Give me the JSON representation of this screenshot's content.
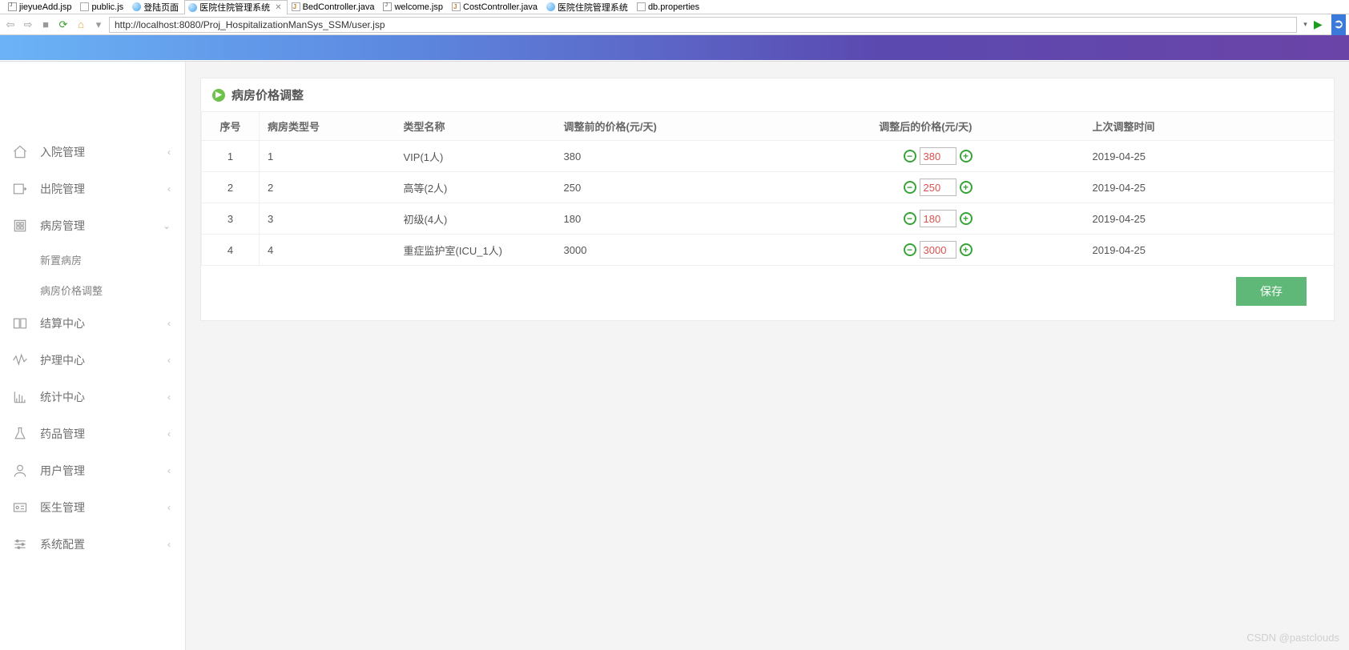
{
  "ide_tabs": [
    {
      "icon": "fi-jsp",
      "label": "jieyueAdd.jsp"
    },
    {
      "icon": "fi-js",
      "label": "public.js"
    },
    {
      "icon": "fi-world",
      "label": "登陆页面"
    },
    {
      "icon": "fi-world",
      "label": "医院住院管理系统",
      "active": true
    },
    {
      "icon": "fi-java",
      "label": "BedController.java"
    },
    {
      "icon": "fi-jsp",
      "label": "welcome.jsp"
    },
    {
      "icon": "fi-java",
      "label": "CostController.java"
    },
    {
      "icon": "fi-world",
      "label": "医院住院管理系统"
    },
    {
      "icon": "fi-prop",
      "label": "db.properties"
    }
  ],
  "url": "http://localhost:8080/Proj_HospitalizationManSys_SSM/user.jsp",
  "sidebar": [
    {
      "icon": "home",
      "label": "入院管理",
      "chev": "left"
    },
    {
      "icon": "out",
      "label": "出院管理",
      "chev": "left"
    },
    {
      "icon": "bed",
      "label": "病房管理",
      "chev": "down",
      "open": true,
      "children": [
        {
          "label": "新置病房"
        },
        {
          "label": "病房价格调整"
        }
      ]
    },
    {
      "icon": "book",
      "label": "结算中心",
      "chev": "left"
    },
    {
      "icon": "wave",
      "label": "护理中心",
      "chev": "left"
    },
    {
      "icon": "chart",
      "label": "统计中心",
      "chev": "left"
    },
    {
      "icon": "flask",
      "label": "药品管理",
      "chev": "left"
    },
    {
      "icon": "user",
      "label": "用户管理",
      "chev": "left"
    },
    {
      "icon": "idcard",
      "label": "医生管理",
      "chev": "left"
    },
    {
      "icon": "sliders",
      "label": "系统配置",
      "chev": "left"
    }
  ],
  "panel_title": "病房价格调整",
  "columns": {
    "seq": "序号",
    "type": "病房类型号",
    "name": "类型名称",
    "before": "调整前的价格(元/天)",
    "after": "调整后的价格(元/天)",
    "date": "上次调整时间"
  },
  "rows": [
    {
      "seq": "1",
      "type": "1",
      "name": "VIP(1人)",
      "before": "380",
      "after": "380",
      "date": "2019-04-25"
    },
    {
      "seq": "2",
      "type": "2",
      "name": "高等(2人)",
      "before": "250",
      "after": "250",
      "date": "2019-04-25"
    },
    {
      "seq": "3",
      "type": "3",
      "name": "初级(4人)",
      "before": "180",
      "after": "180",
      "date": "2019-04-25"
    },
    {
      "seq": "4",
      "type": "4",
      "name": "重症监护室(ICU_1人)",
      "before": "3000",
      "after": "3000",
      "date": "2019-04-25"
    }
  ],
  "save_label": "保存",
  "watermark": "CSDN @pastclouds"
}
